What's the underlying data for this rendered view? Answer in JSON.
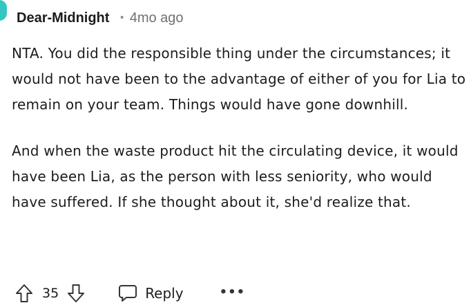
{
  "comment": {
    "author": "Dear-Midnight",
    "separator": "•",
    "timestamp": "4mo ago",
    "paragraphs": [
      "NTA. You did the responsible thing under the circumstances; it would not have been to the advantage of either of you for Lia to remain on your team. Things would have gone downhill.",
      "And when the waste product hit the circulating device, it would have been Lia, as the person with less seniority, who would have suffered. If she thought about it, she'd realize that."
    ]
  },
  "actions": {
    "upvote_icon": "upvote-arrow-icon",
    "score": "35",
    "downvote_icon": "downvote-arrow-icon",
    "reply_icon": "speech-bubble-icon",
    "reply_label": "Reply",
    "more_label": "•••"
  },
  "colors": {
    "avatar_accent": "#34c6c0",
    "text": "#1c1c1c",
    "muted": "#6e7072"
  }
}
